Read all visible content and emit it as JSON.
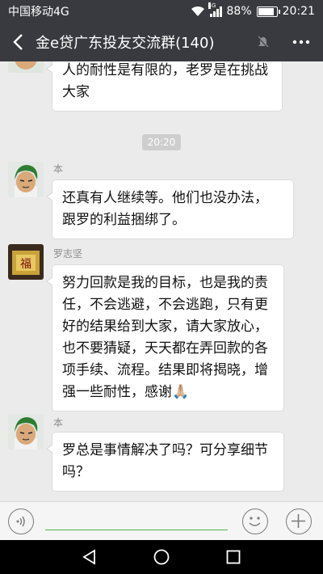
{
  "status_bar": {
    "carrier": "中国移动4G",
    "network_tag": "4G",
    "battery_percent": "88%",
    "battery_level": 0.88,
    "time": "20:21"
  },
  "header": {
    "title": "金e贷广东投友交流群(140)",
    "icons": [
      "back-arrow-icon",
      "mute-bell-icon",
      "more-dots-icon"
    ]
  },
  "messages": [
    {
      "sender": "",
      "lines": [
        "人的耐性是有限的，老罗是在挑战",
        "大家"
      ]
    },
    {
      "type": "timestamp",
      "text": "20:20"
    },
    {
      "sender": "本",
      "lines": [
        "还真有人继续等。他们也没办法，",
        "跟罗的利益捆绑了。"
      ]
    },
    {
      "sender": "罗志坚",
      "lines": [
        "努力回款是我的目标，也是我的责",
        "任，不会逃避，不会逃跑，只有更",
        "好的结果给到大家，请大家放心，",
        "也不要猜疑，天天都在弄回款的各",
        "项手续、流程。结果即将揭晓，增",
        "强一些耐性，感谢🙏🏼"
      ],
      "avatar_text": "福"
    },
    {
      "sender": "本",
      "lines": [
        "罗总是事情解决了吗？可分享细节",
        "吗？"
      ]
    }
  ],
  "input_bar": {
    "icons": [
      "voice-icon",
      "emoji-icon",
      "plus-icon"
    ]
  },
  "nav_bar": {
    "icons": [
      "back-triangle-icon",
      "home-circle-icon",
      "recent-square-icon"
    ]
  },
  "colors": {
    "header_bg": "#393a3f",
    "chat_bg": "#ebebeb",
    "bubble_bg": "#ffffff",
    "input_line": "#4bb74b"
  }
}
